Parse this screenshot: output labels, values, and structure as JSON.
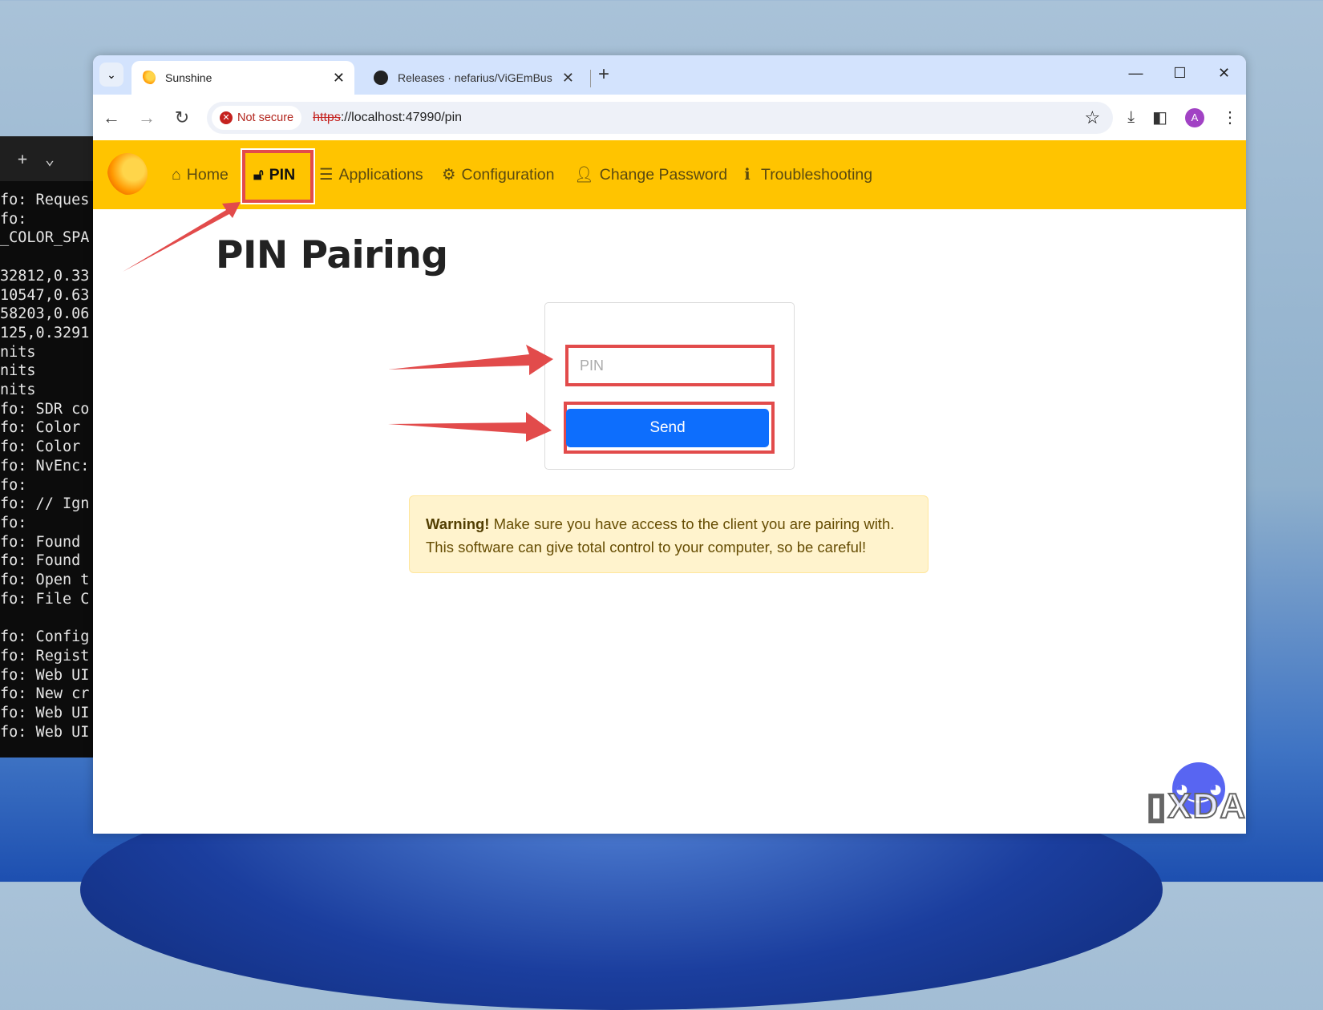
{
  "terminal": {
    "tab_add": "+",
    "tab_menu": "⌄",
    "lines": [
      "fo: Reques",
      "fo:",
      "_COLOR_SPA",
      "",
      "32812,0.33",
      "10547,0.63",
      "58203,0.06",
      "125,0.3291",
      "nits",
      "nits",
      "nits",
      "fo: SDR co",
      "fo: Color",
      "fo: Color",
      "fo: NvEnc:",
      "fo:",
      "fo: // Ign",
      "fo:",
      "fo: Found",
      "fo: Found",
      "fo: Open t",
      "fo: File C",
      "",
      "fo: Config",
      "fo: Regist",
      "fo: Web UI",
      "fo: New cr",
      "fo: Web UI",
      "fo: Web UI"
    ]
  },
  "browser": {
    "tabs": [
      {
        "title": "Sunshine",
        "icon": "sunshine-icon"
      },
      {
        "title": "Releases · nefarius/ViGEmBus",
        "icon": "github-icon"
      }
    ],
    "security_label": "Not secure",
    "url_scheme": "https",
    "url_rest": "://localhost:47990/pin",
    "avatar_letter": "A"
  },
  "nav": {
    "items": [
      {
        "label": "Home",
        "icon": "home-icon"
      },
      {
        "label": "PIN",
        "icon": "unlock-icon"
      },
      {
        "label": "Applications",
        "icon": "list-icon"
      },
      {
        "label": "Configuration",
        "icon": "gear-icon"
      },
      {
        "label": "Change Password",
        "icon": "user-lock-icon"
      },
      {
        "label": "Troubleshooting",
        "icon": "info-icon"
      }
    ]
  },
  "page": {
    "title": "PIN Pairing",
    "pin_placeholder": "PIN",
    "send_label": "Send",
    "warning_strong": "Warning!",
    "warning_text": " Make sure you have access to the client you are pairing with. This software can give total control to your computer, so be careful!"
  },
  "watermark": "XDA",
  "colors": {
    "nav": "#ffc400",
    "primary": "#0d6efd",
    "annotation": "#e24b4b",
    "warning_bg": "#fff3cd"
  }
}
